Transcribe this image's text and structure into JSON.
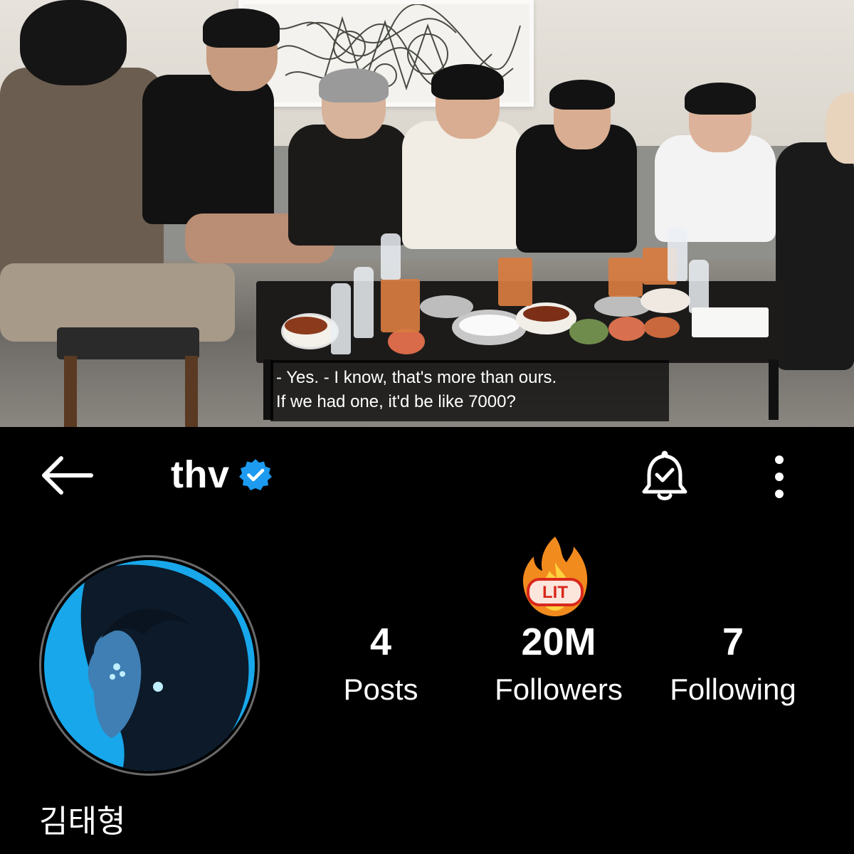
{
  "video": {
    "subtitle_line1": "- Yes. - I know, that's more than ours.",
    "subtitle_line2": "If we had one, it'd be like 7000?"
  },
  "header": {
    "username": "thv",
    "back_icon": "arrow-left-icon",
    "verified_icon": "verified-badge-icon",
    "bell_icon": "bell-check-icon",
    "more_icon": "more-vertical-icon"
  },
  "profile": {
    "full_name": "김태형",
    "sticker_text": "LIT",
    "sticker_icon": "fire-icon"
  },
  "stats": {
    "posts": {
      "count": "4",
      "label": "Posts"
    },
    "followers": {
      "count": "20M",
      "label": "Followers"
    },
    "following": {
      "count": "7",
      "label": "Following"
    }
  },
  "colors": {
    "background": "#000000",
    "text": "#ffffff",
    "verified_blue": "#1d9bf0",
    "avatar_bg": "#19a9ea"
  }
}
